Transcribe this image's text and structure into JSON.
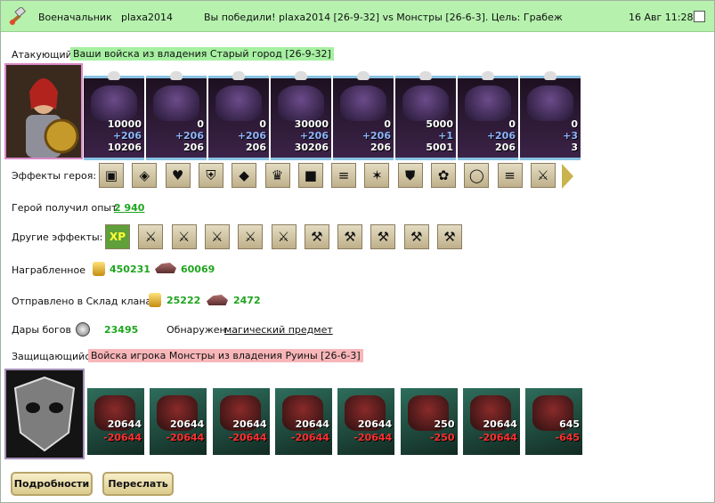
{
  "header": {
    "title": "Военачальник",
    "player": "plaxa2014",
    "result": "Вы победили! plaxa2014 [26-9-32] vs Монстры [26-6-3]. Цель: Грабеж",
    "datetime": "16 Авг 11:28"
  },
  "attacker": {
    "label": "Атакующий",
    "info": "Ваши войска из владения Старый город [26-9-32]"
  },
  "attacker_units": [
    {
      "name": "unit-1",
      "count": "10000",
      "bonus": "+206",
      "total": "10206"
    },
    {
      "name": "unit-2",
      "count": "0",
      "bonus": "+206",
      "total": "206"
    },
    {
      "name": "unit-3",
      "count": "0",
      "bonus": "+206",
      "total": "206"
    },
    {
      "name": "unit-4",
      "count": "30000",
      "bonus": "+206",
      "total": "30206"
    },
    {
      "name": "unit-5",
      "count": "0",
      "bonus": "+206",
      "total": "206"
    },
    {
      "name": "unit-6",
      "count": "5000",
      "bonus": "+1",
      "total": "5001"
    },
    {
      "name": "unit-7",
      "count": "0",
      "bonus": "+206",
      "total": "206"
    },
    {
      "name": "unit-8",
      "count": "0",
      "bonus": "+3",
      "total": "3"
    }
  ],
  "hero_effects": {
    "label": "Эффекты героя:",
    "icons": [
      "chest-icon",
      "treasure-icon",
      "heart-icon",
      "shield-icon",
      "gem-icon",
      "crown-icon",
      "cube-icon",
      "scroll-icon",
      "star-icon",
      "armor-icon",
      "flower-icon",
      "ring-icon",
      "scroll-icon",
      "sword-icon"
    ]
  },
  "experience": {
    "label": "Герой получил опыт:",
    "value": "2 940"
  },
  "other_effects": {
    "label": "Другие эффекты:",
    "xp_badge": "XP",
    "icons": [
      "xp-icon",
      "sword-icon",
      "sword-icon",
      "sword-icon",
      "sword-icon",
      "sword-icon",
      "axe-icon",
      "axe-icon",
      "axe-icon",
      "axe-icon",
      "axe-icon"
    ]
  },
  "loot": {
    "label": "Награбленное",
    "gold": "450231",
    "ore": "60069"
  },
  "clan": {
    "label": "Отправлено в Склад клана",
    "gold": "25222",
    "ore": "2472"
  },
  "gifts": {
    "label": "Дары богов",
    "value": "23495",
    "found_label": "Обнаружен",
    "found_item": "магический предмет"
  },
  "defender": {
    "label": "Защищающийся",
    "info": "Войска игрока Монстры из владения Руины [26-6-3]"
  },
  "defender_units": [
    {
      "count": "20644",
      "loss": "-20644"
    },
    {
      "count": "20644",
      "loss": "-20644"
    },
    {
      "count": "20644",
      "loss": "-20644"
    },
    {
      "count": "20644",
      "loss": "-20644"
    },
    {
      "count": "20644",
      "loss": "-20644"
    },
    {
      "count": "250",
      "loss": "-250"
    },
    {
      "count": "20644",
      "loss": "-20644"
    },
    {
      "count": "645",
      "loss": "-645"
    }
  ],
  "buttons": {
    "details": "Подробности",
    "forward": "Переслать"
  }
}
